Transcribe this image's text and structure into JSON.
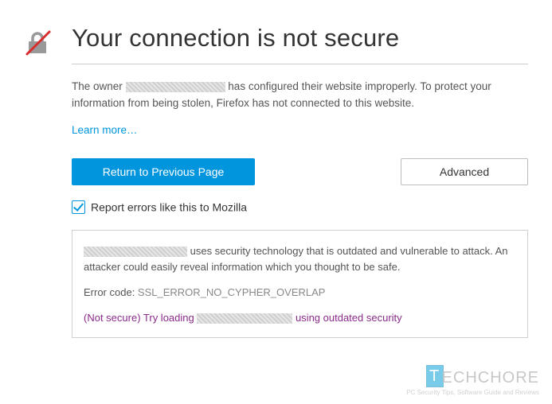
{
  "title": "Your connection is not secure",
  "description": {
    "part1": "The owner ",
    "part2": " has configured their website improperly. To protect your information from being stolen, Firefox has not connected to this website."
  },
  "learn_more": "Learn more…",
  "buttons": {
    "return": "Return to Previous Page",
    "advanced": "Advanced"
  },
  "report_label": "Report errors like this to Mozilla",
  "details": {
    "msg_part1": " uses security technology that is outdated and vulnerable to attack. An attacker could easily reveal information which you thought to be safe.",
    "error_label": "Error code: ",
    "error_code": "SSL_ERROR_NO_CYPHER_OVERLAP",
    "try_prefix": "(Not secure) ",
    "try_mid": "Try loading ",
    "try_suffix": " using outdated security"
  },
  "watermark": {
    "brand_rest": "ECHCHORE",
    "brand_t": "T",
    "tagline": "PC Security Tips, Software Guide and Reviews"
  }
}
